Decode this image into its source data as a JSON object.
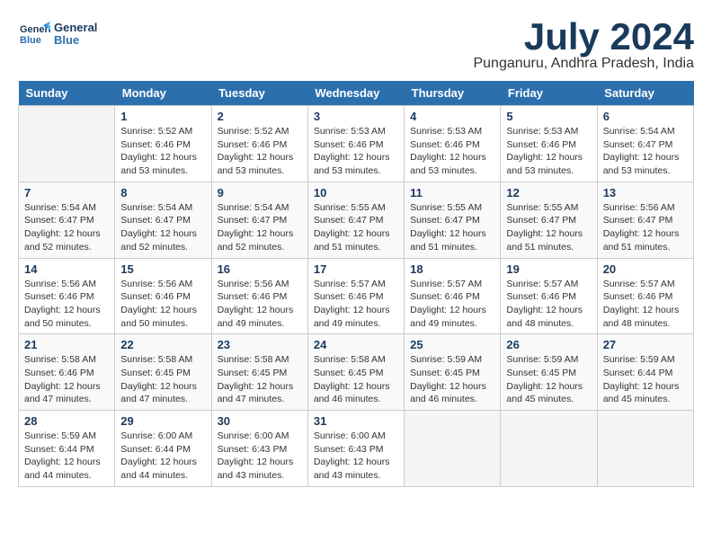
{
  "header": {
    "logo_line1": "General",
    "logo_line2": "Blue",
    "month": "July 2024",
    "location": "Punganuru, Andhra Pradesh, India"
  },
  "weekdays": [
    "Sunday",
    "Monday",
    "Tuesday",
    "Wednesday",
    "Thursday",
    "Friday",
    "Saturday"
  ],
  "weeks": [
    [
      {
        "num": "",
        "sunrise": "",
        "sunset": "",
        "daylight": ""
      },
      {
        "num": "1",
        "sunrise": "Sunrise: 5:52 AM",
        "sunset": "Sunset: 6:46 PM",
        "daylight": "Daylight: 12 hours and 53 minutes."
      },
      {
        "num": "2",
        "sunrise": "Sunrise: 5:52 AM",
        "sunset": "Sunset: 6:46 PM",
        "daylight": "Daylight: 12 hours and 53 minutes."
      },
      {
        "num": "3",
        "sunrise": "Sunrise: 5:53 AM",
        "sunset": "Sunset: 6:46 PM",
        "daylight": "Daylight: 12 hours and 53 minutes."
      },
      {
        "num": "4",
        "sunrise": "Sunrise: 5:53 AM",
        "sunset": "Sunset: 6:46 PM",
        "daylight": "Daylight: 12 hours and 53 minutes."
      },
      {
        "num": "5",
        "sunrise": "Sunrise: 5:53 AM",
        "sunset": "Sunset: 6:46 PM",
        "daylight": "Daylight: 12 hours and 53 minutes."
      },
      {
        "num": "6",
        "sunrise": "Sunrise: 5:54 AM",
        "sunset": "Sunset: 6:47 PM",
        "daylight": "Daylight: 12 hours and 53 minutes."
      }
    ],
    [
      {
        "num": "7",
        "sunrise": "Sunrise: 5:54 AM",
        "sunset": "Sunset: 6:47 PM",
        "daylight": "Daylight: 12 hours and 52 minutes."
      },
      {
        "num": "8",
        "sunrise": "Sunrise: 5:54 AM",
        "sunset": "Sunset: 6:47 PM",
        "daylight": "Daylight: 12 hours and 52 minutes."
      },
      {
        "num": "9",
        "sunrise": "Sunrise: 5:54 AM",
        "sunset": "Sunset: 6:47 PM",
        "daylight": "Daylight: 12 hours and 52 minutes."
      },
      {
        "num": "10",
        "sunrise": "Sunrise: 5:55 AM",
        "sunset": "Sunset: 6:47 PM",
        "daylight": "Daylight: 12 hours and 51 minutes."
      },
      {
        "num": "11",
        "sunrise": "Sunrise: 5:55 AM",
        "sunset": "Sunset: 6:47 PM",
        "daylight": "Daylight: 12 hours and 51 minutes."
      },
      {
        "num": "12",
        "sunrise": "Sunrise: 5:55 AM",
        "sunset": "Sunset: 6:47 PM",
        "daylight": "Daylight: 12 hours and 51 minutes."
      },
      {
        "num": "13",
        "sunrise": "Sunrise: 5:56 AM",
        "sunset": "Sunset: 6:47 PM",
        "daylight": "Daylight: 12 hours and 51 minutes."
      }
    ],
    [
      {
        "num": "14",
        "sunrise": "Sunrise: 5:56 AM",
        "sunset": "Sunset: 6:46 PM",
        "daylight": "Daylight: 12 hours and 50 minutes."
      },
      {
        "num": "15",
        "sunrise": "Sunrise: 5:56 AM",
        "sunset": "Sunset: 6:46 PM",
        "daylight": "Daylight: 12 hours and 50 minutes."
      },
      {
        "num": "16",
        "sunrise": "Sunrise: 5:56 AM",
        "sunset": "Sunset: 6:46 PM",
        "daylight": "Daylight: 12 hours and 49 minutes."
      },
      {
        "num": "17",
        "sunrise": "Sunrise: 5:57 AM",
        "sunset": "Sunset: 6:46 PM",
        "daylight": "Daylight: 12 hours and 49 minutes."
      },
      {
        "num": "18",
        "sunrise": "Sunrise: 5:57 AM",
        "sunset": "Sunset: 6:46 PM",
        "daylight": "Daylight: 12 hours and 49 minutes."
      },
      {
        "num": "19",
        "sunrise": "Sunrise: 5:57 AM",
        "sunset": "Sunset: 6:46 PM",
        "daylight": "Daylight: 12 hours and 48 minutes."
      },
      {
        "num": "20",
        "sunrise": "Sunrise: 5:57 AM",
        "sunset": "Sunset: 6:46 PM",
        "daylight": "Daylight: 12 hours and 48 minutes."
      }
    ],
    [
      {
        "num": "21",
        "sunrise": "Sunrise: 5:58 AM",
        "sunset": "Sunset: 6:46 PM",
        "daylight": "Daylight: 12 hours and 47 minutes."
      },
      {
        "num": "22",
        "sunrise": "Sunrise: 5:58 AM",
        "sunset": "Sunset: 6:45 PM",
        "daylight": "Daylight: 12 hours and 47 minutes."
      },
      {
        "num": "23",
        "sunrise": "Sunrise: 5:58 AM",
        "sunset": "Sunset: 6:45 PM",
        "daylight": "Daylight: 12 hours and 47 minutes."
      },
      {
        "num": "24",
        "sunrise": "Sunrise: 5:58 AM",
        "sunset": "Sunset: 6:45 PM",
        "daylight": "Daylight: 12 hours and 46 minutes."
      },
      {
        "num": "25",
        "sunrise": "Sunrise: 5:59 AM",
        "sunset": "Sunset: 6:45 PM",
        "daylight": "Daylight: 12 hours and 46 minutes."
      },
      {
        "num": "26",
        "sunrise": "Sunrise: 5:59 AM",
        "sunset": "Sunset: 6:45 PM",
        "daylight": "Daylight: 12 hours and 45 minutes."
      },
      {
        "num": "27",
        "sunrise": "Sunrise: 5:59 AM",
        "sunset": "Sunset: 6:44 PM",
        "daylight": "Daylight: 12 hours and 45 minutes."
      }
    ],
    [
      {
        "num": "28",
        "sunrise": "Sunrise: 5:59 AM",
        "sunset": "Sunset: 6:44 PM",
        "daylight": "Daylight: 12 hours and 44 minutes."
      },
      {
        "num": "29",
        "sunrise": "Sunrise: 6:00 AM",
        "sunset": "Sunset: 6:44 PM",
        "daylight": "Daylight: 12 hours and 44 minutes."
      },
      {
        "num": "30",
        "sunrise": "Sunrise: 6:00 AM",
        "sunset": "Sunset: 6:43 PM",
        "daylight": "Daylight: 12 hours and 43 minutes."
      },
      {
        "num": "31",
        "sunrise": "Sunrise: 6:00 AM",
        "sunset": "Sunset: 6:43 PM",
        "daylight": "Daylight: 12 hours and 43 minutes."
      },
      {
        "num": "",
        "sunrise": "",
        "sunset": "",
        "daylight": ""
      },
      {
        "num": "",
        "sunrise": "",
        "sunset": "",
        "daylight": ""
      },
      {
        "num": "",
        "sunrise": "",
        "sunset": "",
        "daylight": ""
      }
    ]
  ]
}
